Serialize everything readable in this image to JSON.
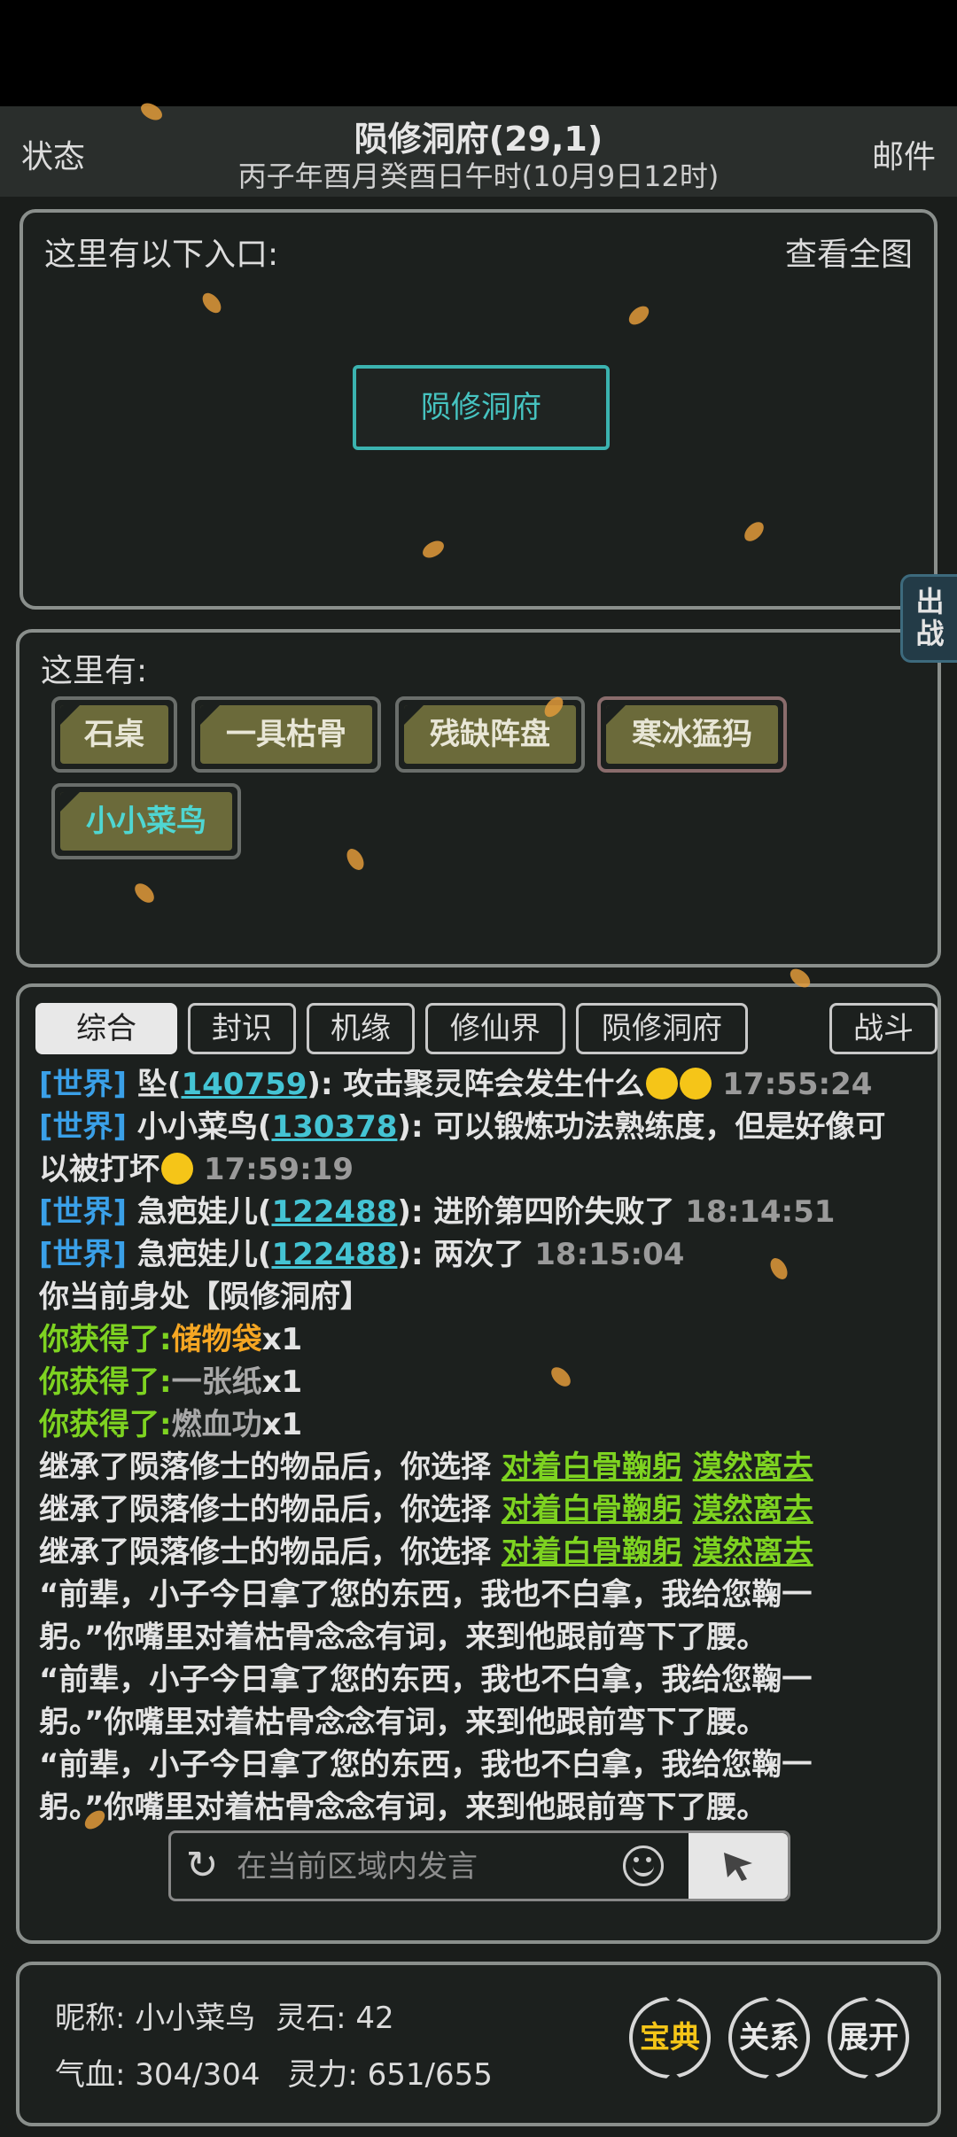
{
  "header": {
    "left": "状态",
    "right": "邮件",
    "title": "陨修洞府(29,1)",
    "date": "丙子年酉月癸酉日午时(10月9日12时)"
  },
  "entrances": {
    "label": "这里有以下入口:",
    "view_map": "查看全图",
    "entry": "陨修洞府"
  },
  "here": {
    "label": "这里有:",
    "items": [
      "石桌",
      "一具枯骨",
      "残缺阵盘",
      "寒冰猛犸",
      "小小菜鸟"
    ]
  },
  "side_tab": "出战",
  "chat": {
    "tabs": [
      "综合",
      "封识",
      "机缘",
      "修仙界",
      "陨修洞府"
    ],
    "battle_tab": "战斗",
    "messages": [
      {
        "ch": "[世界]",
        "name": "坠(",
        "uid": "140759",
        "text": "): 攻击聚灵阵会发生什么",
        "time": "17:55:24"
      },
      {
        "ch": "[世界]",
        "name": "小小菜鸟(",
        "uid": "130378",
        "text": "): 可以锻炼功法熟练度，但是好像可",
        "text2": "以被打坏",
        "time": "17:59:19"
      },
      {
        "ch": "[世界]",
        "name": "急疤娃儿(",
        "uid": "122488",
        "text": "): 进阶第四阶失败了",
        "time": "18:14:51"
      },
      {
        "ch": "[世界]",
        "name": "急疤娃儿(",
        "uid": "122488",
        "text": "): 两次了",
        "time": "18:15:04"
      }
    ],
    "location_msg": "你当前身处【陨修洞府】",
    "obtained_label": "你获得了:",
    "loot": [
      {
        "item": "储物袋",
        "qty": "x1"
      },
      {
        "item": "一张纸",
        "qty": "x1"
      },
      {
        "item": "燃血功",
        "qty": "x1"
      }
    ],
    "choice_prefix": "继承了陨落修士的物品后，你选择",
    "choice_a": "对着白骨鞠躬",
    "choice_b": "漠然离去",
    "story_line1": "“前辈，小子今日拿了您的东西，我也不白拿，我给您鞠一",
    "story_line2": "躬。”你嘴里对着枯骨念念有词，来到他跟前弯下了腰。",
    "input_placeholder": "在当前区域内发言"
  },
  "player": {
    "nickname_label": "昵称:",
    "nickname": "小小菜鸟",
    "stone_label": "灵石:",
    "stone": "42",
    "hp_label": "气血:",
    "hp": "304/304",
    "mp_label": "灵力:",
    "mp": "651/655",
    "btn_treasure": "宝典",
    "btn_relations": "关系",
    "btn_expand": "展开"
  }
}
